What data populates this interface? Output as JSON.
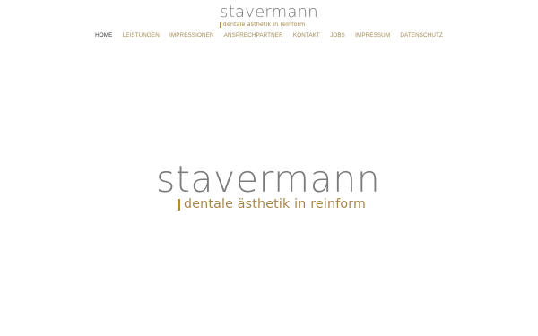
{
  "header": {
    "brand": "stavermann",
    "tagline": "dentale ästhetik in reinform"
  },
  "nav": {
    "items": [
      {
        "label": "HOME",
        "active": true
      },
      {
        "label": "LEISTUNGEN",
        "active": false
      },
      {
        "label": "IMPRESSIONEN",
        "active": false
      },
      {
        "label": "ANSPRECHPARTNER",
        "active": false
      },
      {
        "label": "KONTAKT",
        "active": false
      },
      {
        "label": "JOBS",
        "active": false
      },
      {
        "label": "IMPRESSUM",
        "active": false
      },
      {
        "label": "DATENSCHUTZ",
        "active": false
      }
    ]
  },
  "hero": {
    "brand": "stavermann",
    "tagline": "dentale ästhetik in reinform"
  },
  "colors": {
    "brand_gray": "#7b7b7b",
    "accent_gold": "#a8864a",
    "nav_active": "#333333",
    "background": "#ffffff"
  }
}
